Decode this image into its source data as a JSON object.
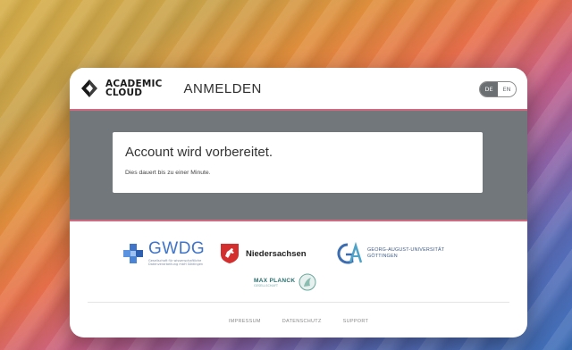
{
  "brand": {
    "line1": "ACADEMIC",
    "line2": "CLOUD"
  },
  "header": {
    "title": "ANMELDEN"
  },
  "language": {
    "options": [
      "DE",
      "EN"
    ],
    "selected": "DE"
  },
  "status": {
    "title": "Account wird vorbereitet.",
    "subtitle": "Dies dauert bis zu einer Minute."
  },
  "logos": {
    "gwdg": {
      "name": "GWDG",
      "tagline": "Gesellschaft für wissenschaftliche Datenverarbeitung mbH Göttingen"
    },
    "niedersachsen": {
      "name": "Niedersachsen"
    },
    "goettingen": {
      "line1": "GEORG-AUGUST-UNIVERSITÄT",
      "line2": "GÖTTINGEN"
    },
    "maxplanck": {
      "name": "MAX PLANCK",
      "tagline": "GESELLSCHAFT"
    }
  },
  "footer": {
    "links": [
      "IMPRESSUM",
      "DATENSCHUTZ",
      "SUPPORT"
    ]
  },
  "colors": {
    "accent_line": "#d06a80",
    "status_band": "#72777b",
    "gwdg_blue": "#3f74c9",
    "nds_red": "#d32f2f"
  }
}
